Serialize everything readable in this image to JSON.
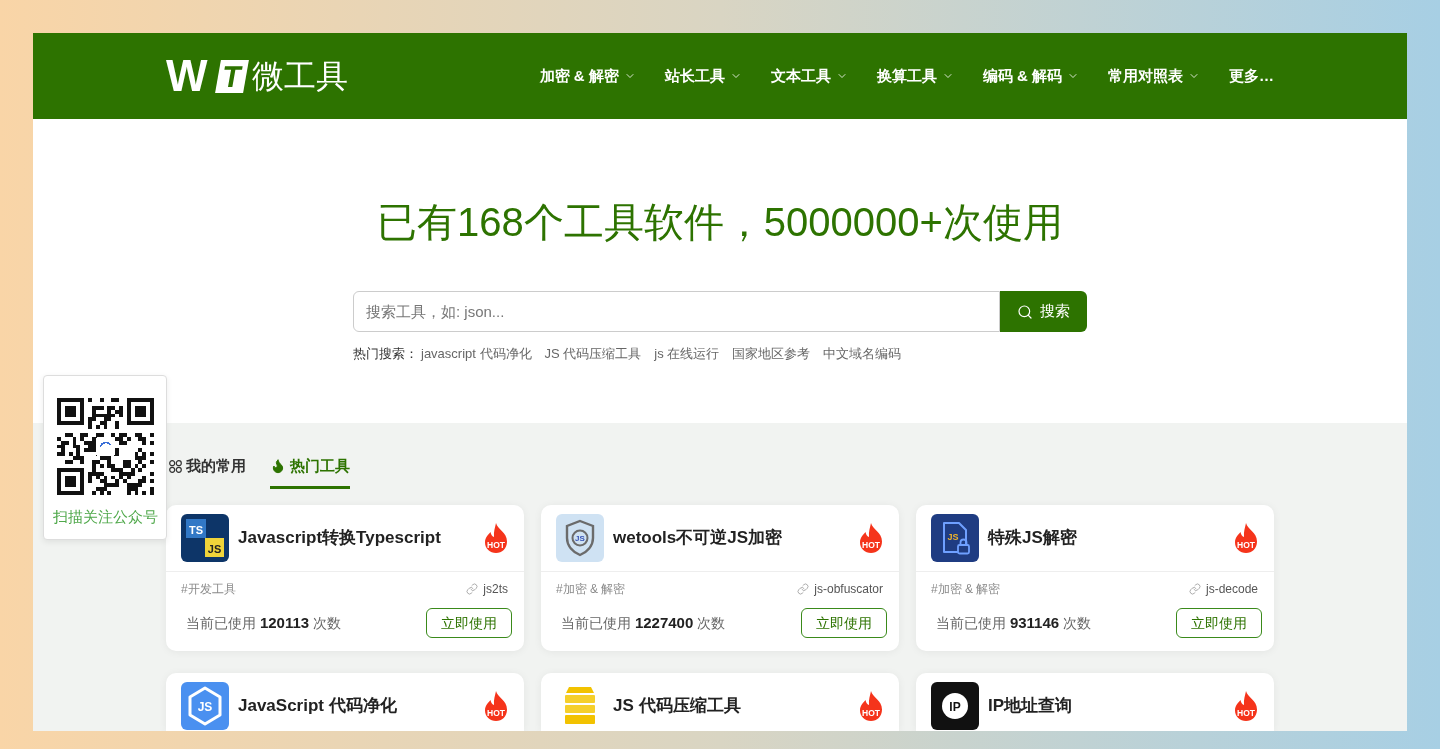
{
  "header": {
    "logo": {
      "mark": [
        "W",
        "T"
      ],
      "name": "微工具"
    },
    "nav": [
      {
        "label": "加密 & 解密",
        "has_menu": true
      },
      {
        "label": "站长工具",
        "has_menu": true
      },
      {
        "label": "文本工具",
        "has_menu": true
      },
      {
        "label": "换算工具",
        "has_menu": true
      },
      {
        "label": "编码 & 解码",
        "has_menu": true
      },
      {
        "label": "常用对照表",
        "has_menu": true
      },
      {
        "label": "更多…",
        "has_menu": false
      }
    ]
  },
  "hero": {
    "headline": "已有168个工具软件，5000000+次使用",
    "search": {
      "placeholder": "搜索工具，如: json...",
      "button": "搜索"
    },
    "hot_searches": {
      "label": "热门搜索：",
      "links": [
        "javascript 代码净化",
        "JS 代码压缩工具",
        "js 在线运行",
        "国家地区参考",
        "中文域名编码"
      ]
    }
  },
  "qr_panel": {
    "caption": "扫描关注公众号"
  },
  "tabs": [
    {
      "label": "我的常用",
      "selected": false
    },
    {
      "label": "热门工具",
      "selected": true
    }
  ],
  "cards": [
    {
      "logo_text": [
        "TS",
        "JS"
      ],
      "title": "Javascript转换Typescript",
      "badge": "HOT",
      "tag": "#开发工具",
      "slug": "js2ts",
      "usage": "当前已使用 **120113** 次数",
      "button": "立即使用"
    },
    {
      "logo_text": [
        "JS"
      ],
      "title": "wetools不可逆JS加密",
      "badge": "HOT",
      "tag": "#加密 & 解密",
      "slug": "js-obfuscator",
      "usage": "当前已使用 **1227400** 次数",
      "button": "立即使用"
    },
    {
      "logo_text": [
        "JS"
      ],
      "title": "特殊JS解密",
      "badge": "HOT",
      "tag": "#加密 & 解密",
      "slug": "js-decode",
      "usage": "当前已使用 **931146** 次数",
      "button": "立即使用"
    },
    {
      "logo_text": [
        "JS"
      ],
      "title": "JavaScript 代码净化",
      "badge": "HOT"
    },
    {
      "title": "JS 代码压缩工具",
      "badge": "HOT"
    },
    {
      "logo_text": [
        "IP"
      ],
      "title": "IP地址查询",
      "badge": "HOT"
    }
  ]
}
